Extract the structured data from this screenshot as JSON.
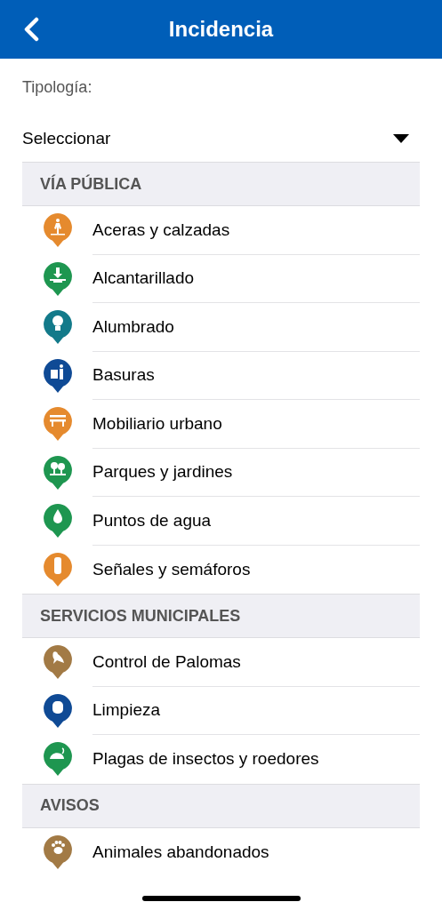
{
  "header": {
    "title": "Incidencia"
  },
  "field": {
    "label": "Tipología:",
    "value": "Seleccionar"
  },
  "sections": [
    {
      "title": "VÍA PÚBLICA",
      "items": [
        {
          "label": "Aceras y calzadas",
          "color": "#e58a2e",
          "kind": "pedestrian"
        },
        {
          "label": "Alcantarillado",
          "color": "#1e9650",
          "kind": "drain"
        },
        {
          "label": "Alumbrado",
          "color": "#137a8a",
          "kind": "bulb"
        },
        {
          "label": "Basuras",
          "color": "#0f4a95",
          "kind": "bin"
        },
        {
          "label": "Mobiliario urbano",
          "color": "#e58a2e",
          "kind": "bench"
        },
        {
          "label": "Parques y jardines",
          "color": "#1e9650",
          "kind": "trees"
        },
        {
          "label": "Puntos de agua",
          "color": "#1e9650",
          "kind": "drop"
        },
        {
          "label": "Señales y semáforos",
          "color": "#e58a2e",
          "kind": "light"
        }
      ]
    },
    {
      "title": "SERVICIOS MUNICIPALES",
      "items": [
        {
          "label": "Control de Palomas",
          "color": "#a27a45",
          "kind": "bird"
        },
        {
          "label": "Limpieza",
          "color": "#0f4a95",
          "kind": "recycle"
        },
        {
          "label": "Plagas de insectos y roedores",
          "color": "#1e9650",
          "kind": "mouse"
        }
      ]
    },
    {
      "title": "AVISOS",
      "items": [
        {
          "label": "Animales abandonados",
          "color": "#a27a45",
          "kind": "paw"
        }
      ]
    }
  ]
}
